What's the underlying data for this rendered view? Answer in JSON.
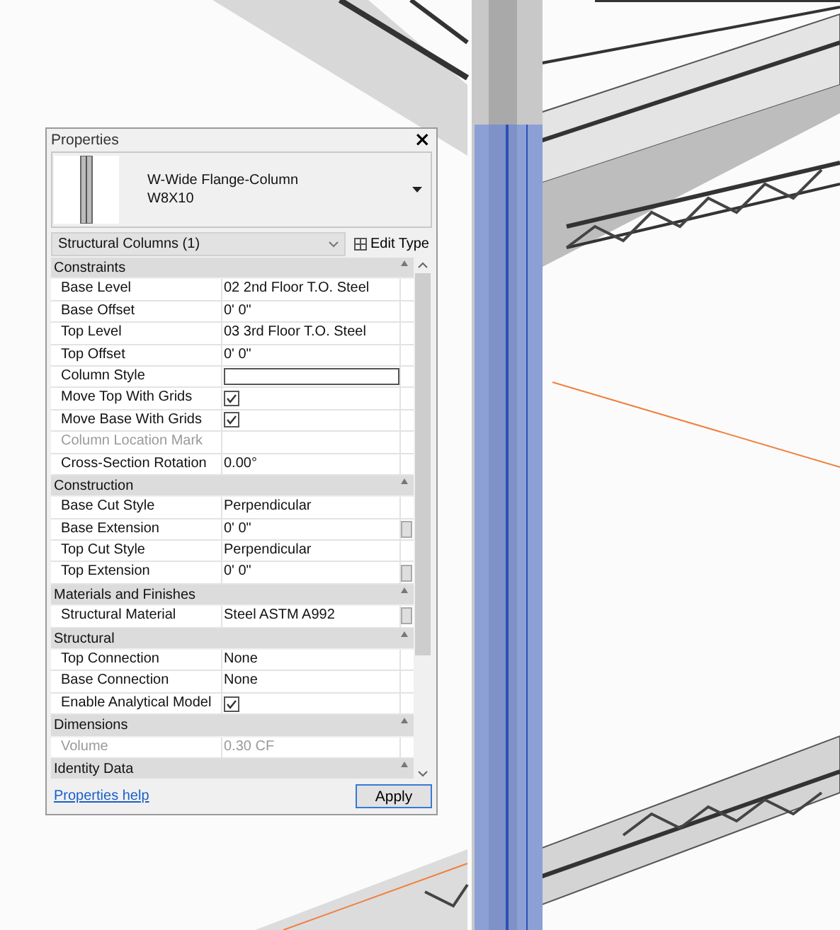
{
  "panel": {
    "title": "Properties",
    "close": "×"
  },
  "type_selector": {
    "name": "W-Wide Flange-Column",
    "size": "W8X10"
  },
  "filter": {
    "label": "Structural Columns (1)",
    "edit_type": "Edit Type"
  },
  "sections": [
    {
      "title": "Constraints",
      "rows": [
        {
          "label": "Base Level",
          "kind": "text",
          "value": "02 2nd Floor T.O. Steel",
          "disabled": false,
          "picker": false
        },
        {
          "label": "Base Offset",
          "kind": "text",
          "value": "0'  0\"",
          "disabled": false,
          "picker": false
        },
        {
          "label": "Top Level",
          "kind": "text",
          "value": "03 3rd Floor T.O. Steel",
          "disabled": false,
          "picker": false
        },
        {
          "label": "Top Offset",
          "kind": "text",
          "value": "0'  0\"",
          "disabled": false,
          "picker": false
        },
        {
          "label": "Column Style",
          "kind": "input",
          "disabled": false,
          "picker": false
        },
        {
          "label": "Move Top With Grids",
          "kind": "checkbox",
          "checked": true,
          "disabled": false,
          "picker": false
        },
        {
          "label": "Move Base With Grids",
          "kind": "checkbox",
          "checked": true,
          "disabled": false,
          "picker": false
        },
        {
          "label": "Column Location Mark",
          "kind": "text",
          "disabled": true,
          "picker": false
        },
        {
          "label": "Cross-Section Rotation",
          "kind": "text",
          "value": "0.00°",
          "disabled": false,
          "picker": false
        }
      ]
    },
    {
      "title": "Construction",
      "rows": [
        {
          "label": "Base Cut Style",
          "kind": "text",
          "value": "Perpendicular",
          "disabled": false,
          "picker": false
        },
        {
          "label": "Base Extension",
          "kind": "text",
          "value": "0'  0\"",
          "disabled": false,
          "picker": true
        },
        {
          "label": "Top Cut Style",
          "kind": "text",
          "value": "Perpendicular",
          "disabled": false,
          "picker": false
        },
        {
          "label": "Top Extension",
          "kind": "text",
          "value": "0'  0\"",
          "disabled": false,
          "picker": true
        }
      ]
    },
    {
      "title": "Materials and Finishes",
      "rows": [
        {
          "label": "Structural Material",
          "kind": "text",
          "value": "Steel ASTM A992",
          "disabled": false,
          "picker": true
        }
      ]
    },
    {
      "title": "Structural",
      "rows": [
        {
          "label": "Top Connection",
          "kind": "text",
          "value": "None",
          "disabled": false,
          "picker": false
        },
        {
          "label": "Base Connection",
          "kind": "text",
          "value": "None",
          "disabled": false,
          "picker": false
        },
        {
          "label": "Enable Analytical Model",
          "kind": "checkbox",
          "checked": true,
          "disabled": false,
          "picker": false
        }
      ]
    },
    {
      "title": "Dimensions",
      "rows": [
        {
          "label": "Volume",
          "kind": "text",
          "value": "0.30 CF",
          "disabled": true,
          "picker": false
        }
      ]
    },
    {
      "title": "Identity Data"
    }
  ],
  "footer": {
    "help_link": "Properties help",
    "apply": "Apply"
  }
}
